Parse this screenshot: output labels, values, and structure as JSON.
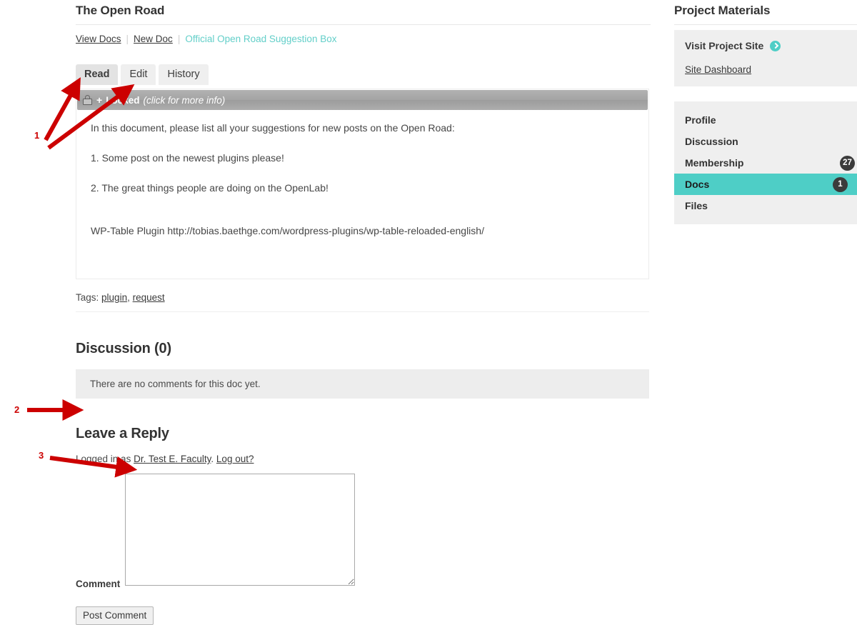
{
  "document": {
    "title": "The Open Road",
    "nav": {
      "view_docs": "View Docs",
      "new_doc": "New Doc",
      "current": "Official Open Road Suggestion Box",
      "separator": "|"
    },
    "tabs": [
      {
        "label": "Read",
        "active": true
      },
      {
        "label": "Edit",
        "active": false
      },
      {
        "label": "History",
        "active": false
      }
    ],
    "locked_bar": {
      "plus": "+",
      "label": "Locked",
      "hint": "(click for more info)",
      "icon": "lock-icon"
    },
    "body": {
      "intro": "In this document, please list all your suggestions for new posts on the Open Road:",
      "item_1": "1. Some post on the newest plugins please!",
      "item_2": "2. The great things people are doing on the OpenLab!",
      "footer_note": "WP-Table Plugin http://tobias.baethge.com/wordpress-plugins/wp-table-reloaded-english/"
    },
    "tags": {
      "label": "Tags:",
      "items": [
        "plugin",
        "request"
      ],
      "comma": ","
    }
  },
  "discussion": {
    "heading": "Discussion (0)",
    "empty_message": "There are no comments for this doc yet."
  },
  "reply": {
    "heading": "Leave a Reply",
    "logged_in_prefix": "Logged in as",
    "user_name": "Dr. Test E. Faculty",
    "period": ".",
    "logout_label": "Log out?",
    "comment_label": "Comment",
    "comment_value": "",
    "comment_placeholder": "",
    "post_button": "Post Comment"
  },
  "sidebar": {
    "title": "Project Materials",
    "visit_site": {
      "label": "Visit Project Site",
      "icon": "arrow-circle-right-icon"
    },
    "site_dashboard": "Site Dashboard",
    "nav_items": [
      {
        "label": "Profile",
        "badge": "",
        "active": false
      },
      {
        "label": "Discussion",
        "badge": "",
        "active": false
      },
      {
        "label": "Membership",
        "badge": "27",
        "active": false
      },
      {
        "label": "Docs",
        "badge": "1",
        "active": true
      },
      {
        "label": "Files",
        "badge": "",
        "active": false
      }
    ]
  },
  "annotations": [
    {
      "number": "1"
    },
    {
      "number": "2"
    },
    {
      "number": "3"
    }
  ],
  "colors": {
    "accent_teal": "#4ecec6",
    "annotation_red": "#cc0000",
    "panel_gray": "#efefef",
    "locked_gray": "#a4a4a4"
  }
}
